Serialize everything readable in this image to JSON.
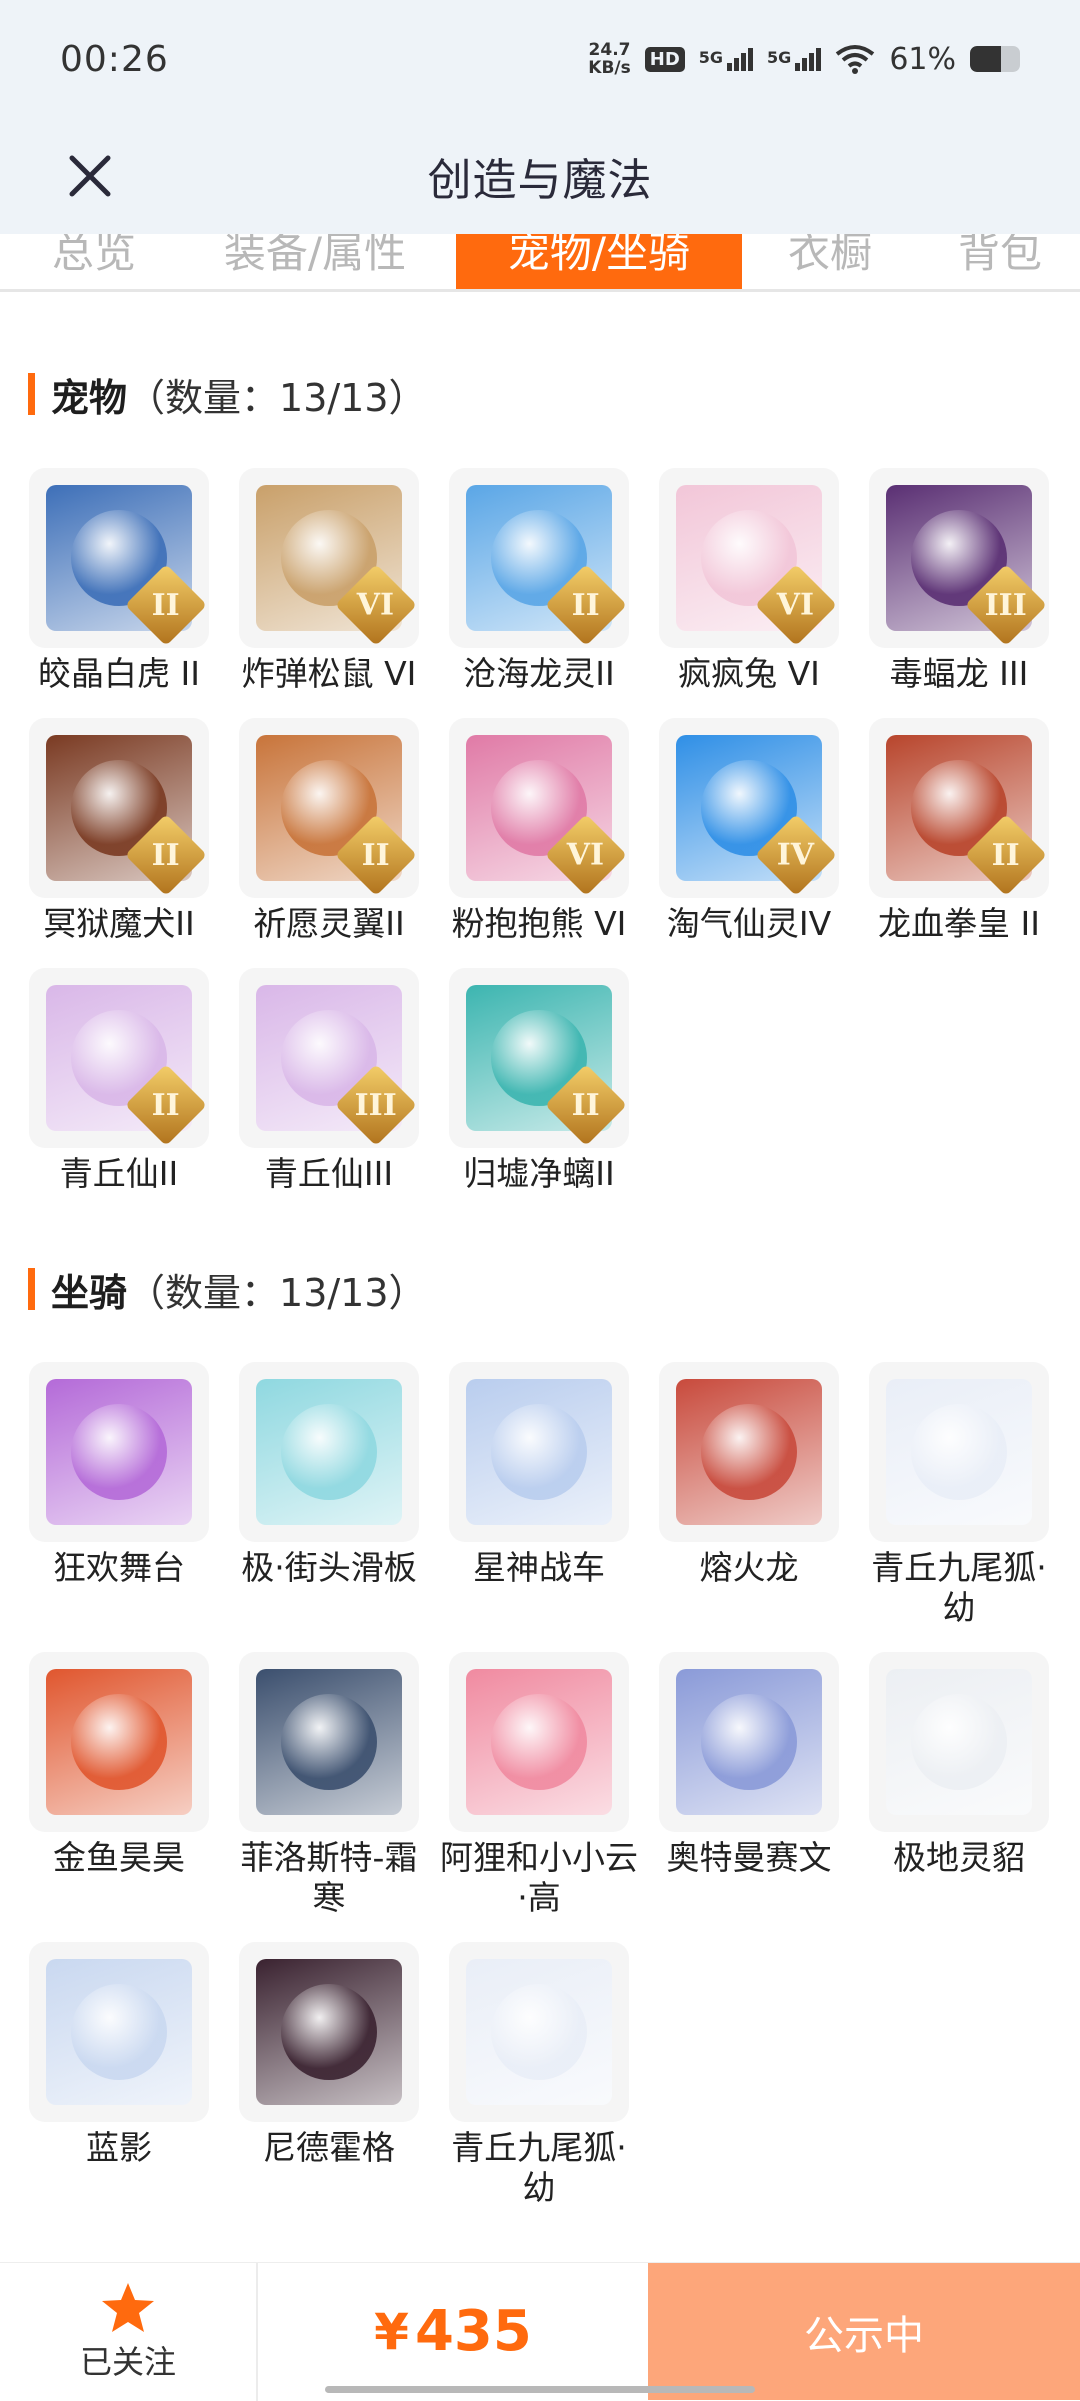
{
  "status_bar": {
    "time": "00:26",
    "net_speed_value": "24.7",
    "net_speed_unit": "KB/s",
    "hd_label": "HD",
    "sim1_label": "5G",
    "sim2_label": "5G",
    "battery_percent": "61%",
    "battery_level": 0.61
  },
  "header": {
    "title": "创造与魔法",
    "close_icon": "close-icon"
  },
  "tabs": [
    {
      "label": "总览"
    },
    {
      "label": "装备/属性"
    },
    {
      "label": "宠物/坐骑",
      "active": true
    },
    {
      "label": "衣橱"
    },
    {
      "label": "背包"
    }
  ],
  "pets": {
    "title": "宠物",
    "count": "（数量：13/13）",
    "items": [
      {
        "name": "皎晶白虎 II",
        "rank": "II",
        "color": "#3d6fb8"
      },
      {
        "name": "炸弹松鼠 VI",
        "rank": "VI",
        "color": "#c9a06a"
      },
      {
        "name": "沧海龙灵II",
        "rank": "II",
        "color": "#5aa6e6"
      },
      {
        "name": "疯疯兔 VI",
        "rank": "VI",
        "color": "#f2c6d8"
      },
      {
        "name": "毒蝠龙 III",
        "rank": "III",
        "color": "#5a2f73"
      },
      {
        "name": "冥狱魔犬II",
        "rank": "II",
        "color": "#7a3a22"
      },
      {
        "name": "祈愿灵翼II",
        "rank": "II",
        "color": "#c8743a"
      },
      {
        "name": "粉抱抱熊 VI",
        "rank": "VI",
        "color": "#e07aa6"
      },
      {
        "name": "淘气仙灵IV",
        "rank": "IV",
        "color": "#2f8fe6"
      },
      {
        "name": "龙血拳皇 II",
        "rank": "II",
        "color": "#b8452c"
      },
      {
        "name": "青丘仙II",
        "rank": "II",
        "color": "#d9b7e8"
      },
      {
        "name": "青丘仙III",
        "rank": "III",
        "color": "#d9b7e8"
      },
      {
        "name": "归墟净螭II",
        "rank": "II",
        "color": "#3cb5b0"
      }
    ]
  },
  "mounts": {
    "title": "坐骑",
    "count": "（数量：13/13）",
    "items": [
      {
        "name": "狂欢舞台",
        "color": "#b46ad8"
      },
      {
        "name": "极·街头滑板",
        "color": "#8fd8e0"
      },
      {
        "name": "星神战车",
        "color": "#b9cdee"
      },
      {
        "name": "熔火龙",
        "color": "#c84a3c"
      },
      {
        "name": "青丘九尾狐·幼",
        "color": "#e9eef7"
      },
      {
        "name": "金鱼昊昊",
        "color": "#e0562e"
      },
      {
        "name": "菲洛斯特-霜寒",
        "color": "#3b4f6e"
      },
      {
        "name": "阿狸和小小云·高",
        "color": "#f08aa0"
      },
      {
        "name": "奥特曼赛文",
        "color": "#8a9ad8"
      },
      {
        "name": "极地灵貂",
        "color": "#eceff3"
      },
      {
        "name": "蓝影",
        "color": "#c9d8f0"
      },
      {
        "name": "尼德霍格",
        "color": "#3a2230"
      },
      {
        "name": "青丘九尾狐·幼",
        "color": "#e9eef7"
      }
    ]
  },
  "bottom": {
    "follow_label": "已关注",
    "price_symbol": "¥",
    "price_value": "435",
    "status_label": "公示中"
  }
}
